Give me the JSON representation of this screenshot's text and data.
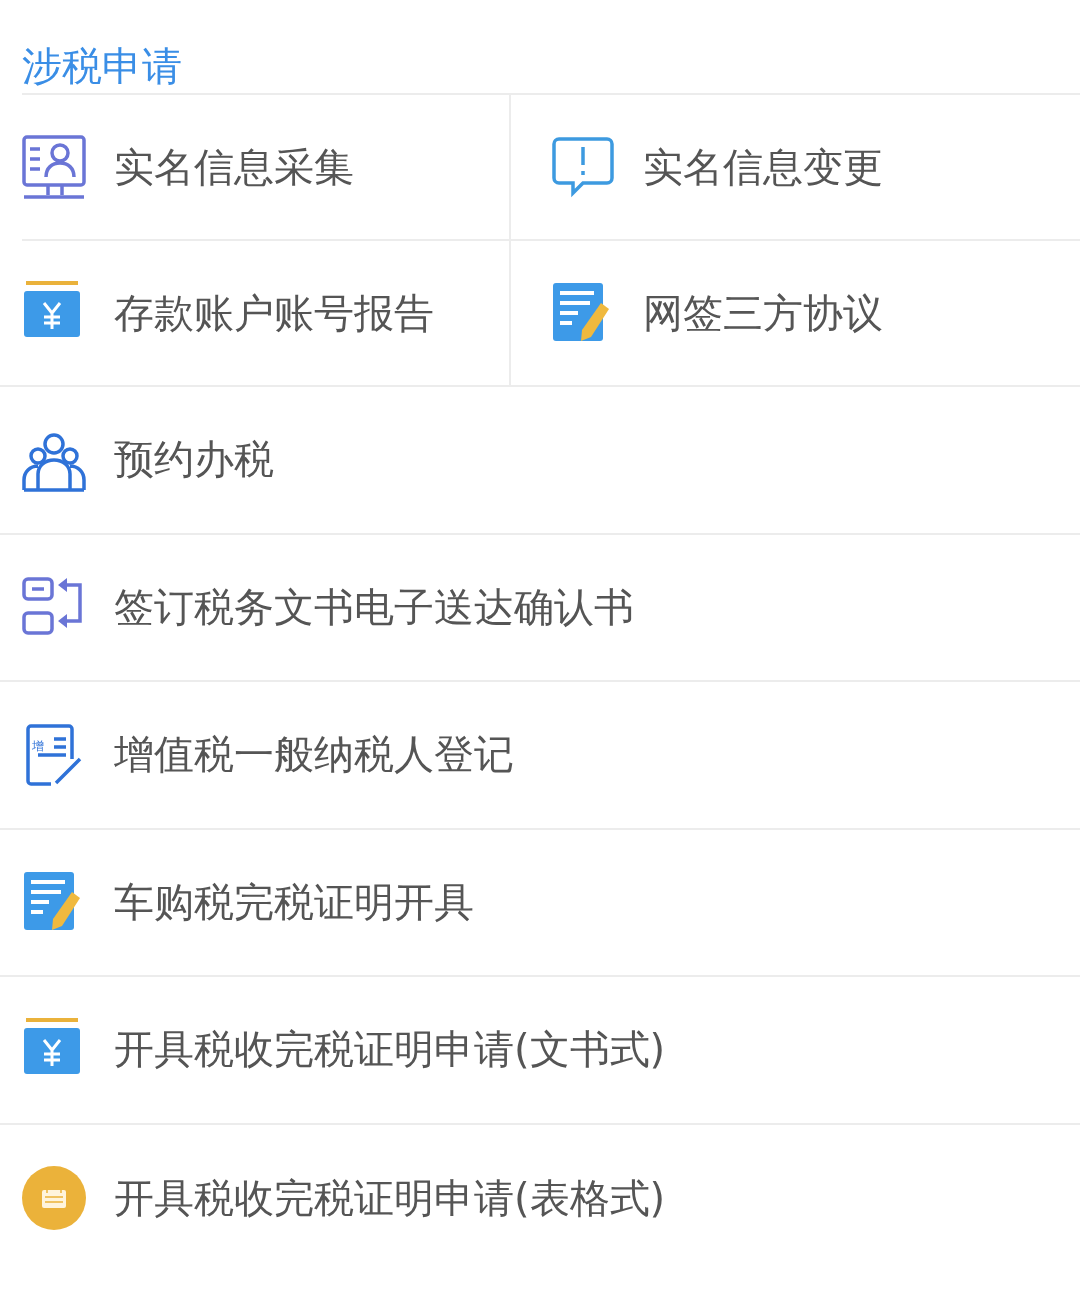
{
  "section_title": "涉税申请",
  "grid_items": [
    {
      "label": "实名信息采集",
      "kind": "idcard"
    },
    {
      "label": "实名信息变更",
      "kind": "bubble"
    },
    {
      "label": "存款账户账号报告",
      "kind": "money"
    },
    {
      "label": "网签三方协议",
      "kind": "docpen"
    }
  ],
  "list_items": [
    {
      "label": "预约办税",
      "kind": "people"
    },
    {
      "label": "签订税务文书电子送达确认书",
      "kind": "swap"
    },
    {
      "label": "增值税一般纳税人登记",
      "kind": "form",
      "icon_text": "增"
    },
    {
      "label": "车购税完税证明开具",
      "kind": "docpen"
    },
    {
      "label": "开具税收完税证明申请(文书式)",
      "kind": "money"
    },
    {
      "label": "开具税收完税证明申请(表格式)",
      "kind": "calendar"
    }
  ]
}
